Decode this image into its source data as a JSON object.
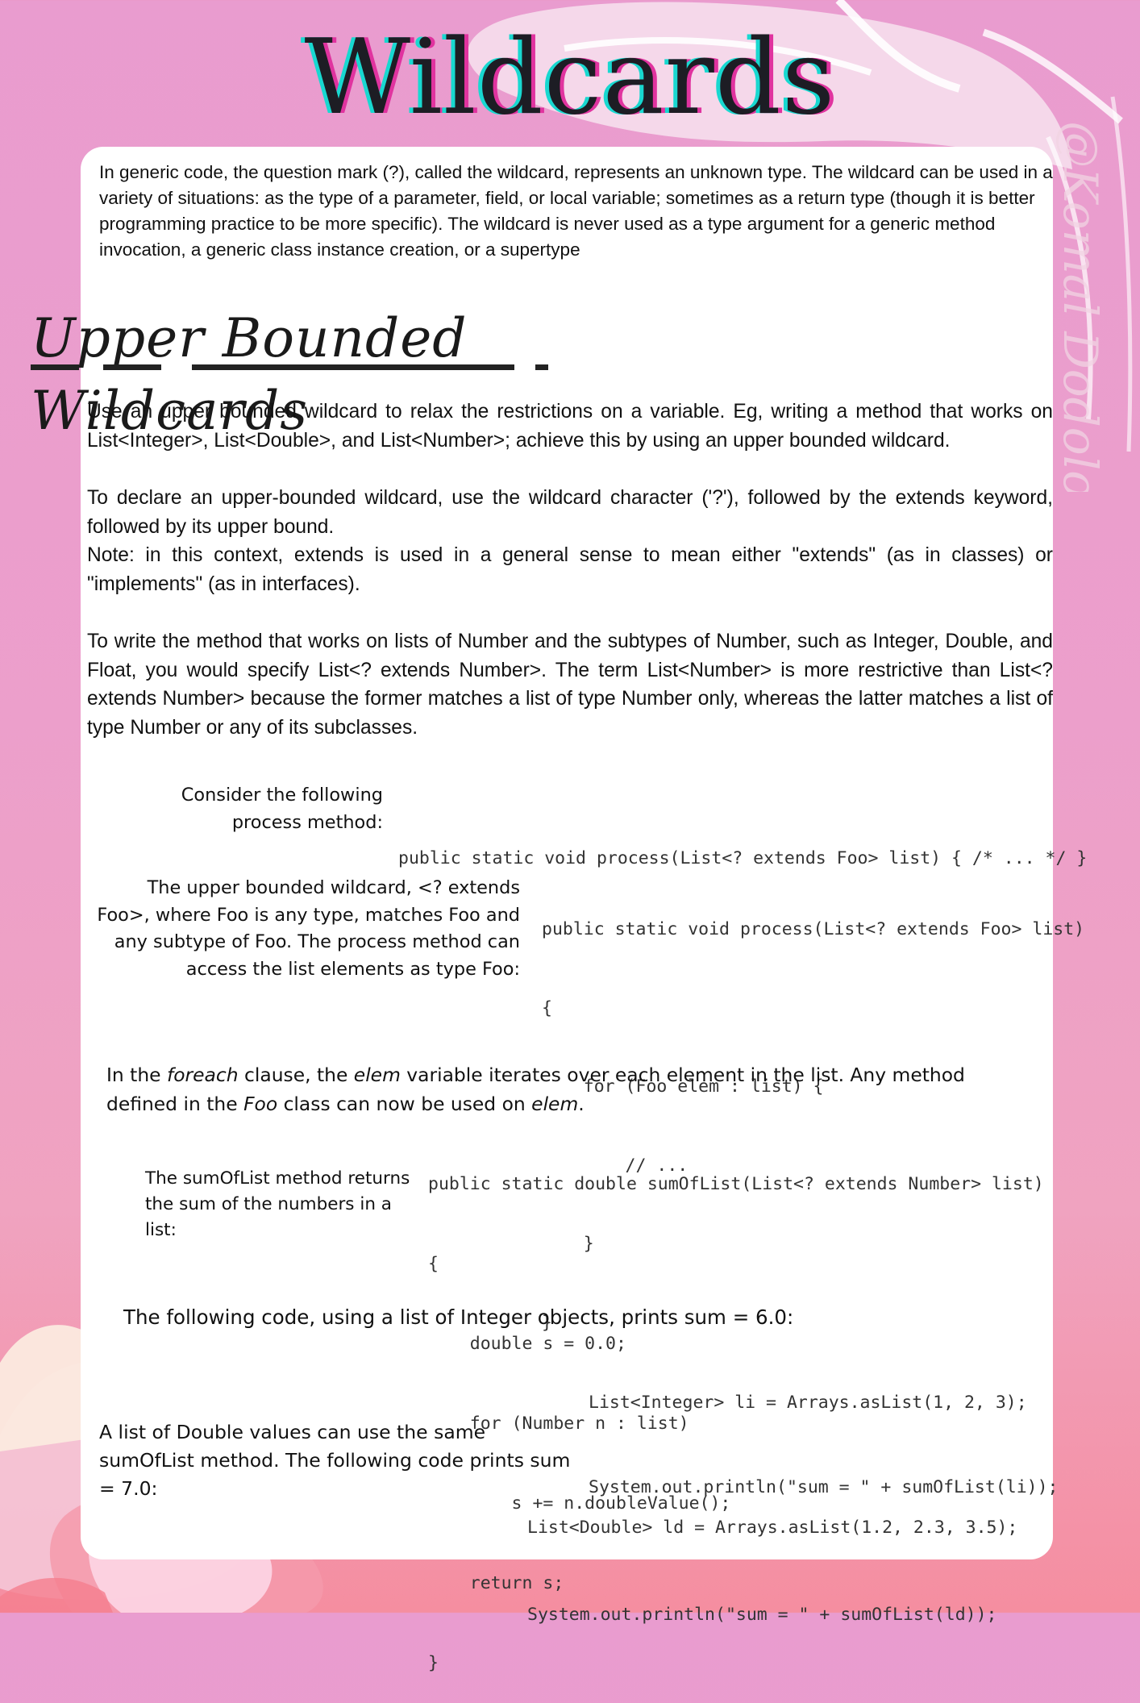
{
  "title": "Wildcards",
  "watermark": "@Komal Dodolo",
  "intro": "In generic code, the question mark (?), called the wildcard, represents an unknown type. The wildcard can be used in a variety of situations: as the type of a parameter, field, or local variable; sometimes as a return type (though it is better programming practice to be more specific). The wildcard is never used as a type argument for a generic method invocation, a generic class instance creation, or a supertype",
  "section_heading": "Upper Bounded Wildcards",
  "paragraphs": {
    "p1": "Use an upper bounded wildcard to relax the restrictions on a variable. Eg, writing a method that works on List<Integer>, List<Double>, and List<Number>; achieve this by using an upper bounded wildcard.",
    "p2a": "To declare an upper-bounded wildcard, use the wildcard character ('?'), followed by the extends keyword, followed by its upper bound.",
    "p2b": "Note: in this context, extends is used in a general sense to mean either \"extends\" (as in classes) or \"implements\" (as in interfaces).",
    "p3": "To write the method that works on lists of Number and the subtypes of Number, such as Integer, Double, and Float, you would specify List<? extends Number>. The term List<Number> is more restrictive than List<? extends Number> because the former matches a list of type Number only, whereas the latter matches a list of type Number or any of its subclasses."
  },
  "example1": {
    "label": "Consider the following process method:",
    "code": [
      "public static void process(List<? extends Foo> list) { /* ... */ }"
    ]
  },
  "example2": {
    "label": "The upper bounded wildcard, <? extends Foo>, where Foo is any type, matches Foo and any subtype of Foo. The process method can access the list elements as type Foo:",
    "code": [
      "public static void process(List<? extends Foo> list)",
      "{",
      "    for (Foo elem : list) {",
      "        // ...",
      "    }",
      "}"
    ]
  },
  "foreach_note": {
    "t1": "In the ",
    "i1": "foreach",
    "t2": " clause, the ",
    "i2": "elem",
    "t3": " variable iterates over each element in the list. Any method defined in the ",
    "i3": "Foo",
    "t4": " class can now be used on ",
    "i4": "elem",
    "t5": "."
  },
  "example3": {
    "label": "The sumOfList method returns the sum of the numbers in a list:",
    "code": [
      "public static double sumOfList(List<? extends Number> list)",
      "{",
      "    double s = 0.0;",
      "    for (Number n : list)",
      "        s += n.doubleValue();",
      "    return s;",
      "}"
    ]
  },
  "example4": {
    "label": "The following code, using a list of Integer objects, prints sum = 6.0:",
    "code": [
      "List<Integer> li = Arrays.asList(1, 2, 3);",
      "System.out.println(\"sum = \" + sumOfList(li));"
    ]
  },
  "example5": {
    "label": "A list of Double values can use the same sumOfList method. The following code prints sum = 7.0:",
    "code": [
      "List<Double> ld = Arrays.asList(1.2, 2.3, 3.5);",
      "System.out.println(\"sum = \" + sumOfList(ld));"
    ]
  },
  "colors": {
    "background_top": "#e99ccf",
    "background_bottom": "#f58ea0",
    "title_shadow_cyan": "#18d8d0",
    "title_shadow_magenta": "#e0339f",
    "card": "#ffffff"
  }
}
